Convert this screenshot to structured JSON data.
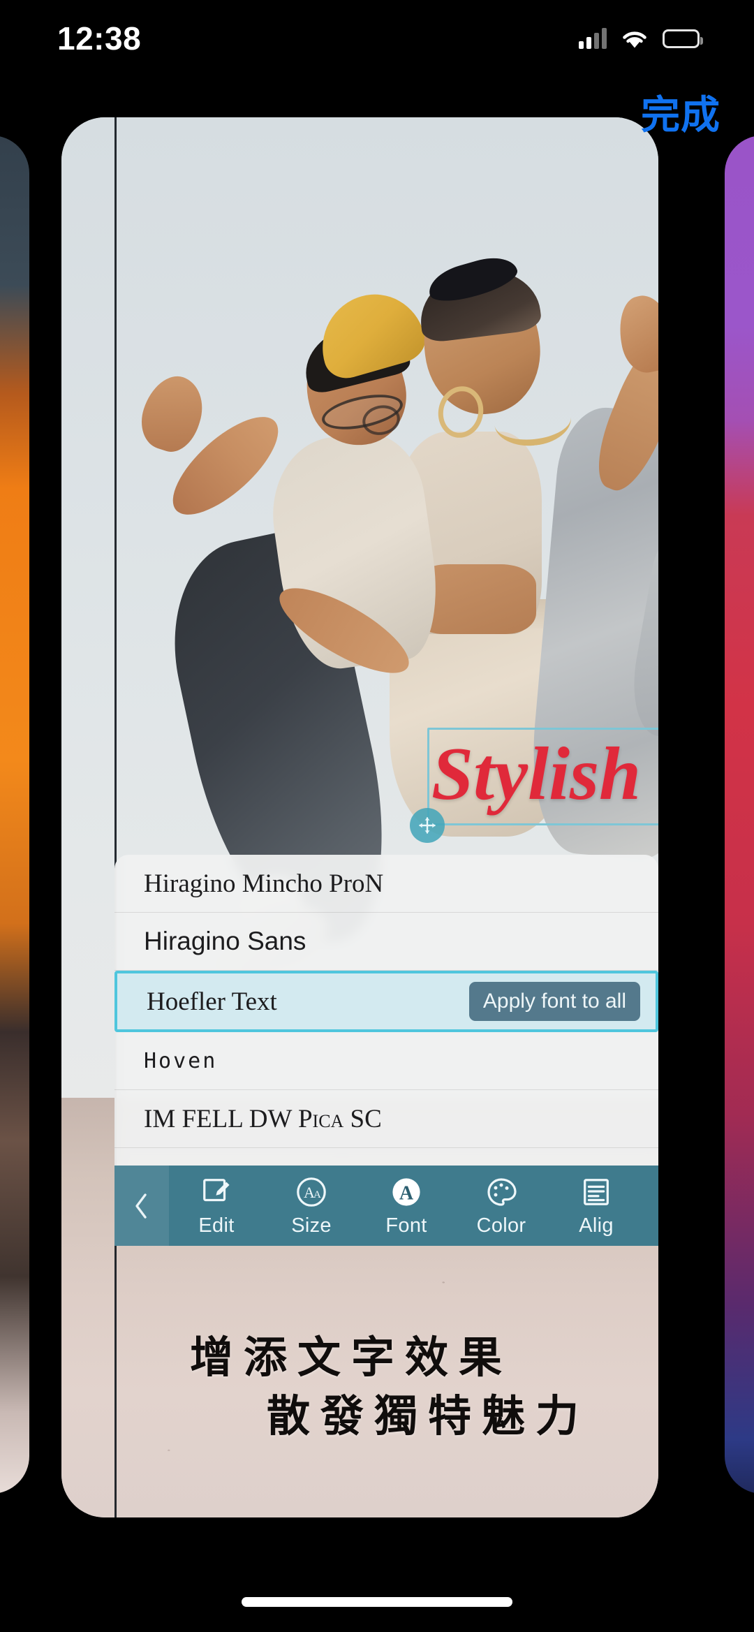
{
  "status_bar": {
    "time": "12:38",
    "cellular_icon": "cellular-signal-icon",
    "wifi_icon": "wifi-icon",
    "battery_icon": "battery-icon"
  },
  "nav": {
    "done_label": "完成"
  },
  "canvas": {
    "text_object": {
      "value": "Stylish",
      "color": "#e0293a",
      "style": "italic-serif",
      "handles": {
        "resize": "resize-diagonal-icon",
        "rotate": "rotate-icon",
        "move": "move-arrows-icon"
      },
      "selection_color": "#7ec6d6"
    },
    "caption": {
      "line1": "增添文字效果",
      "line2": "散發獨特魅力"
    }
  },
  "font_panel": {
    "selected_index": 2,
    "apply_button_label": "Apply font to all",
    "selection_color": "#4fc6dd",
    "selection_bg": "#d3eaf0",
    "apply_button_bg": "#54798c",
    "fonts": [
      {
        "name": "Hiragino Mincho ProN"
      },
      {
        "name": "Hiragino Sans"
      },
      {
        "name": "Hoefler Text"
      },
      {
        "name": "Hoven"
      },
      {
        "name": "IM FELL DW Pica SC"
      }
    ]
  },
  "toolbar": {
    "background": "#3f7b8d",
    "back_icon": "chevron-left-icon",
    "items": [
      {
        "label": "Edit",
        "icon": "pencil-square-icon",
        "active": false
      },
      {
        "label": "Size",
        "icon": "aa-circle-icon",
        "active": false
      },
      {
        "label": "Font",
        "icon": "a-filled-circle-icon",
        "active": true
      },
      {
        "label": "Color",
        "icon": "palette-icon",
        "active": false
      },
      {
        "label": "Alig",
        "icon": "align-lines-icon",
        "active": false
      }
    ]
  },
  "carousel": {
    "previous_card": "orange-portrait-thumbnail",
    "next_card": "purple-red-gradient-thumbnail"
  },
  "colors": {
    "accent_blue": "#1072f0",
    "text_red": "#e0293a",
    "teal": "#4fc6dd",
    "toolbar_teal": "#3f7b8d"
  }
}
